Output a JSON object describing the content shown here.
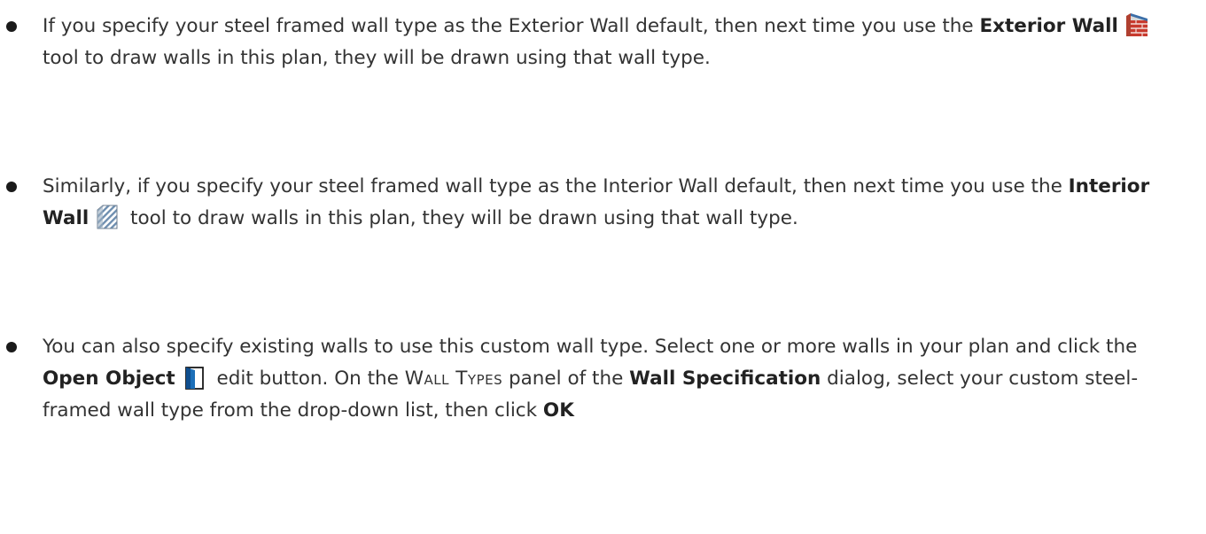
{
  "colors": {
    "text": "#333333",
    "bullet": "#1a1a1a",
    "exterior_wall_icon_red": "#c83a2e",
    "interior_wall_icon_blue": "#6f8fb0",
    "open_object_icon_blue": "#1c6fb8"
  },
  "bullets": [
    {
      "t1": "If you specify your steel framed wall type as the Exterior Wall default, then next time you use the ",
      "bold": "Exterior Wall",
      "icon": "exterior-wall-tool-icon",
      "t2": " tool to draw walls in this plan, they will be drawn using that wall type."
    },
    {
      "t1": "Similarly, if you specify your steel framed wall type as the Interior Wall default, then next time you use the ",
      "bold": "Interior Wall",
      "icon": "interior-wall-tool-icon",
      "t2": " tool to draw walls in this plan, they will be drawn using that wall type."
    },
    {
      "t1": "You can also specify existing walls to use this custom wall type. Select one or more walls in your plan and click the ",
      "bold1": "Open Object",
      "icon": "open-object-icon",
      "t2": " edit button. On the ",
      "smallcaps": "Wall Types",
      "t3": " panel of the ",
      "bold2": "Wall Specification",
      "t4": " dialog, select your custom steel-framed wall type from the drop-down list, then click ",
      "bold3": "OK"
    }
  ]
}
